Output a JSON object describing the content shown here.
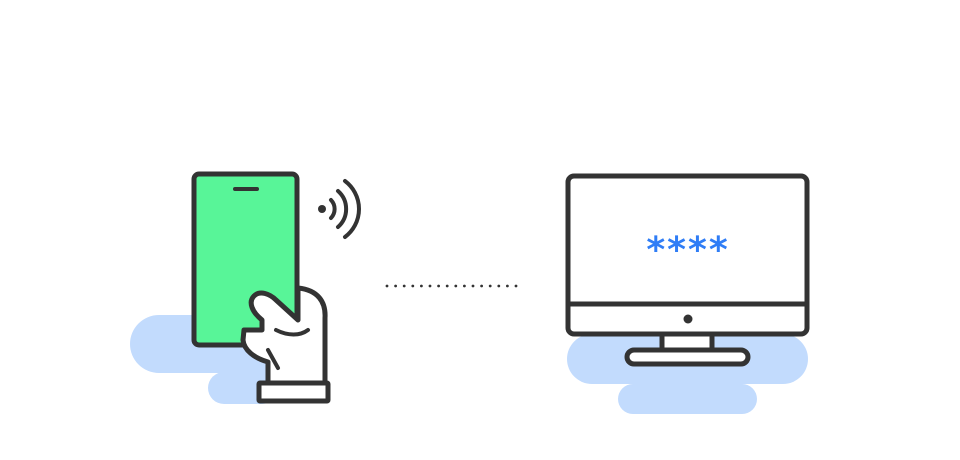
{
  "password_mask": "****",
  "colors": {
    "outline": "#333333",
    "phone_screen": "#58f598",
    "shadow_blob": "#c2dbfd",
    "password_text": "#2f7df6",
    "background": "#ffffff"
  },
  "icons": {
    "phone": "smartphone-icon",
    "hand": "hand-icon",
    "signal": "contactless-signal-icon",
    "connection": "dotted-connection-line",
    "monitor": "desktop-monitor-icon"
  }
}
